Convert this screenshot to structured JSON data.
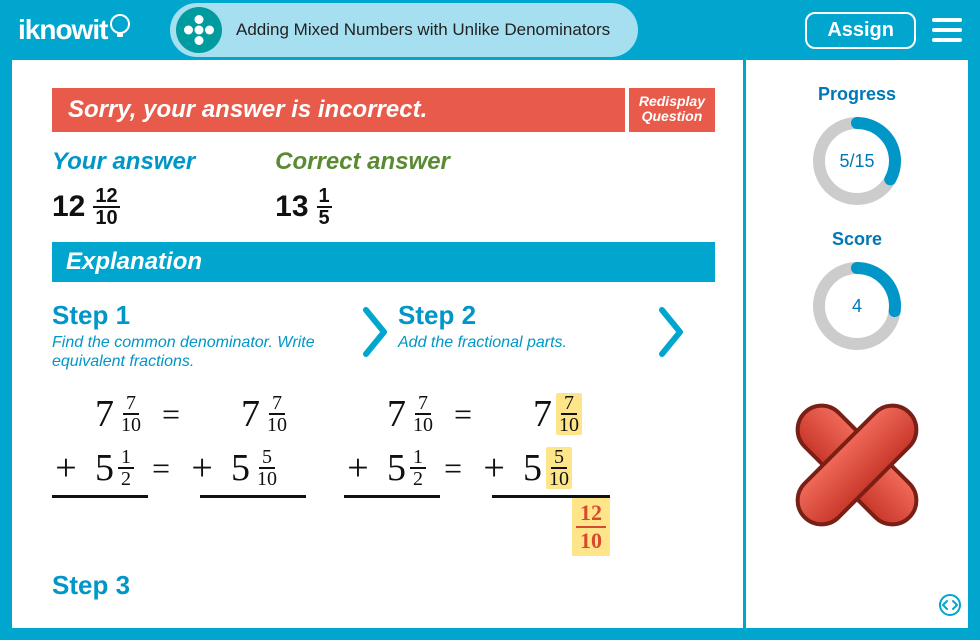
{
  "header": {
    "logo_text": "iknowit",
    "title": "Adding Mixed Numbers with Unlike Denominators",
    "assign_label": "Assign"
  },
  "feedback": {
    "message": "Sorry, your answer is incorrect.",
    "redisplay_label_line1": "Redisplay",
    "redisplay_label_line2": "Question"
  },
  "answers": {
    "your_label": "Your answer",
    "your_whole": "12",
    "your_num": "12",
    "your_den": "10",
    "correct_label": "Correct answer",
    "correct_whole": "13",
    "correct_num": "1",
    "correct_den": "5"
  },
  "explanation_label": "Explanation",
  "steps": {
    "s1_title": "Step 1",
    "s1_sub": "Find the common denominator. Write equivalent fractions.",
    "s2_title": "Step 2",
    "s2_sub": "Add the fractional parts.",
    "s3_title": "Step 3"
  },
  "work": {
    "a_whole": "7",
    "a_num": "7",
    "a_den": "10",
    "a2_whole": "7",
    "a2_num": "7",
    "a2_den": "10",
    "b_whole": "5",
    "b_num": "1",
    "b_den": "2",
    "b2_whole": "5",
    "b2_num": "5",
    "b2_den": "10",
    "sum_num": "12",
    "sum_den": "10"
  },
  "sidebar": {
    "progress_label": "Progress",
    "progress_text": "5/15",
    "progress_percent": 33,
    "score_label": "Score",
    "score_text": "4",
    "score_percent": 27
  }
}
